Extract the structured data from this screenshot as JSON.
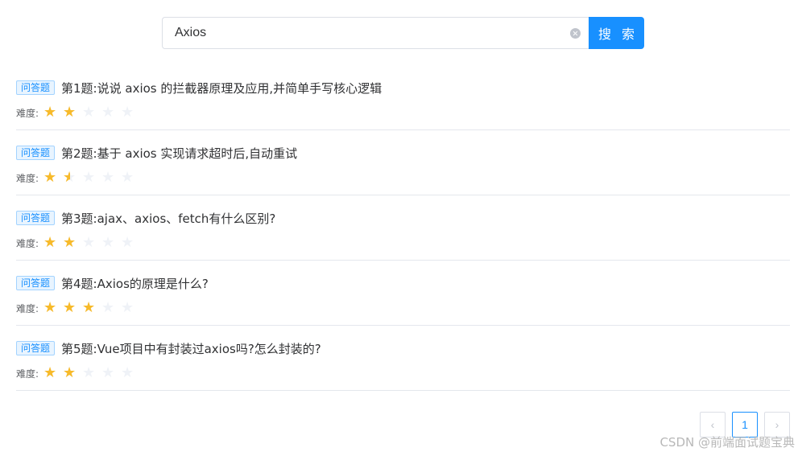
{
  "search": {
    "value": "Axios",
    "button_label": "搜 索"
  },
  "difficulty_label": "难度:",
  "questions": [
    {
      "tag": "问答题",
      "title": "第1题:说说 axios 的拦截器原理及应用,并简单手写核心逻辑",
      "rating": 2
    },
    {
      "tag": "问答题",
      "title": "第2题:基于 axios 实现请求超时后,自动重试",
      "rating": 1.5
    },
    {
      "tag": "问答题",
      "title": "第3题:ajax、axios、fetch有什么区别?",
      "rating": 2
    },
    {
      "tag": "问答题",
      "title": "第4题:Axios的原理是什么?",
      "rating": 3
    },
    {
      "tag": "问答题",
      "title": "第5题:Vue项目中有封装过axios吗?怎么封装的?",
      "rating": 2
    }
  ],
  "max_rating": 5,
  "pagination": {
    "prev_icon": "‹",
    "current_page": "1",
    "next_icon": "›"
  },
  "watermark": "CSDN @前端面试题宝典",
  "colors": {
    "accent": "#1890ff",
    "star_on": "#f7ba2a",
    "star_off": "#eff2f7"
  }
}
